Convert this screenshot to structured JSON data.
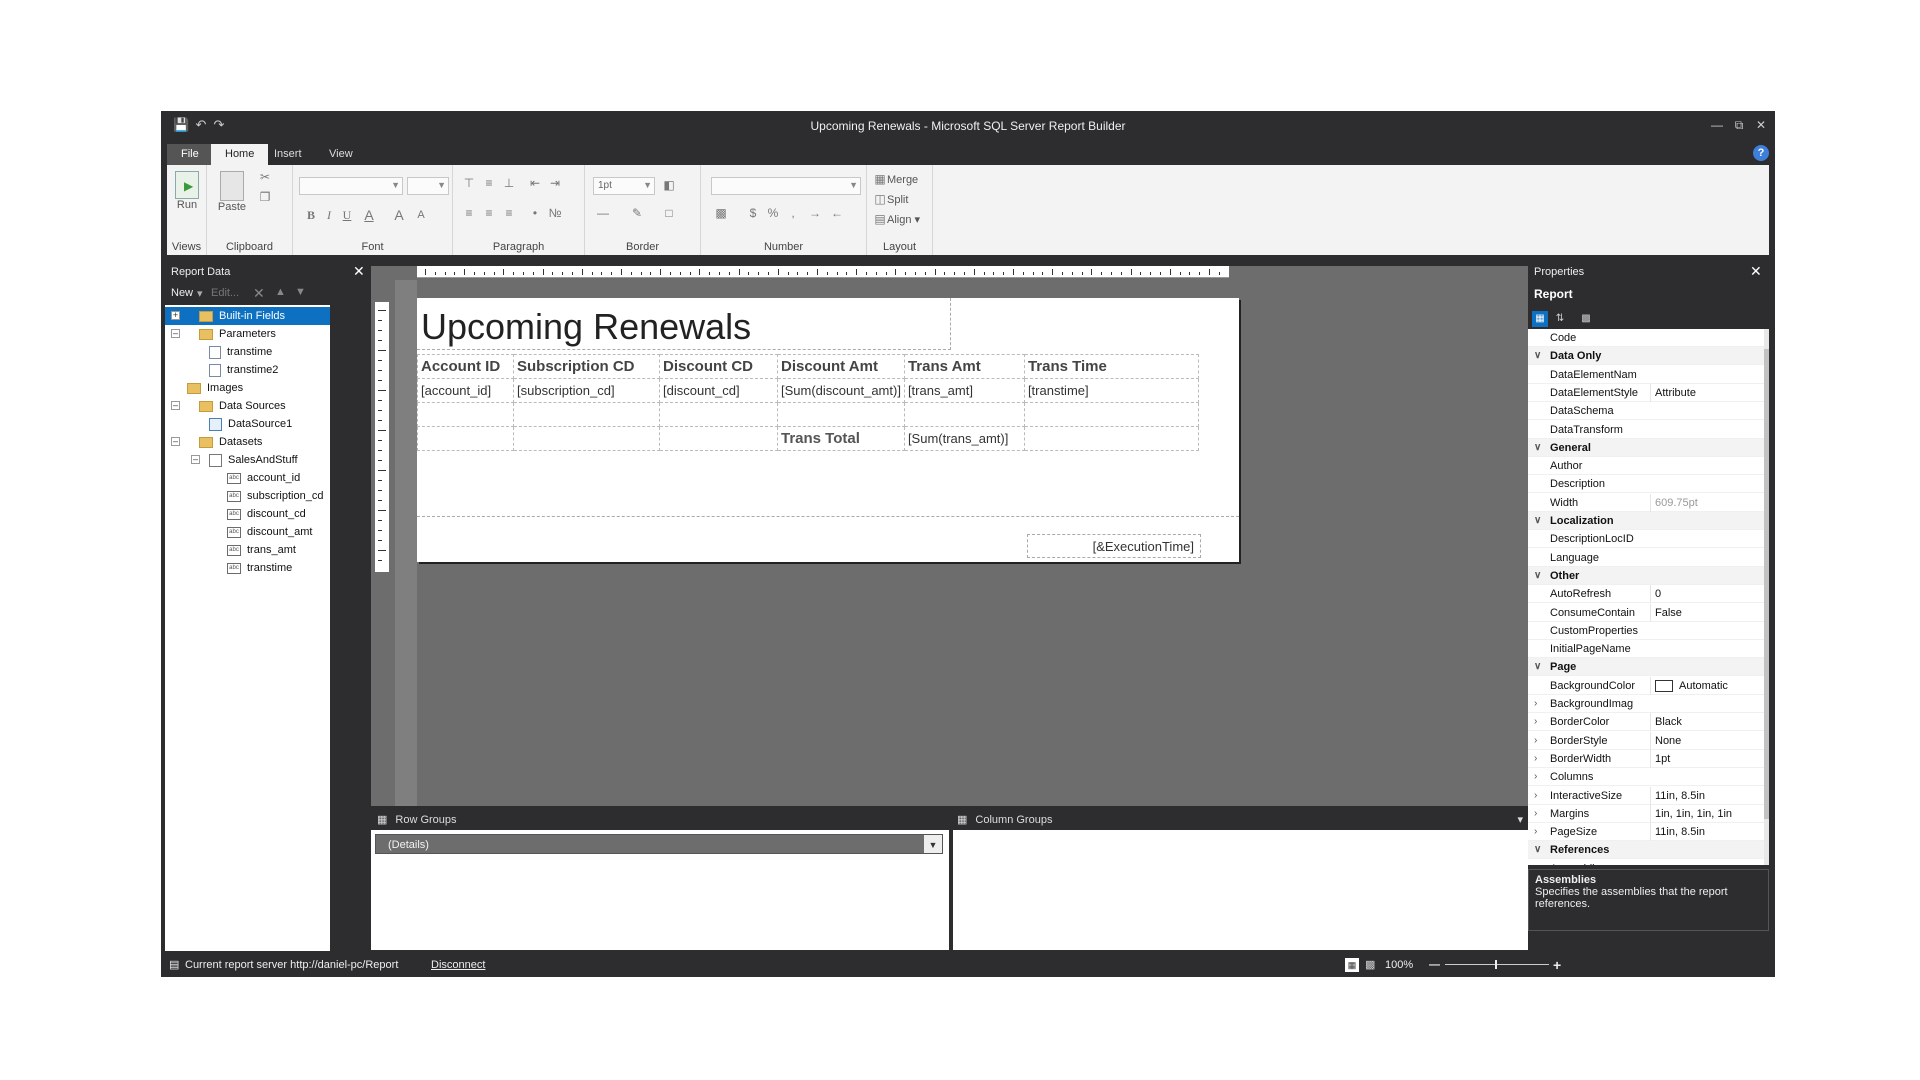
{
  "window": {
    "title": "Upcoming Renewals - Microsoft SQL Server Report Builder"
  },
  "menu": {
    "file": "File",
    "home": "Home",
    "insert": "Insert",
    "view": "View",
    "help": "?"
  },
  "ribbon": {
    "run": "Run",
    "paste": "Paste",
    "groups": {
      "views": "Views",
      "clipboard": "Clipboard",
      "font": "Font",
      "paragraph": "Paragraph",
      "border": "Border",
      "number": "Number",
      "layout": "Layout"
    },
    "border_width": "1pt",
    "merge": "Merge",
    "split": "Split",
    "align": "Align",
    "bold": "B",
    "italic": "I",
    "underline": "U",
    "fontcolor": "A",
    "fontsize_up": "A",
    "number_currency": "$",
    "number_percent": "%",
    "number_comma": ","
  },
  "report_data": {
    "title": "Report Data",
    "toolbar": {
      "new": "New",
      "edit": "Edit..."
    },
    "tree": {
      "builtin": "Built-in Fields",
      "parameters": "Parameters",
      "param1": "transtime",
      "param2": "transtime2",
      "images": "Images",
      "datasources": "Data Sources",
      "datasource1": "DataSource1",
      "datasets": "Datasets",
      "dataset1": "SalesAndStuff",
      "fields": [
        "account_id",
        "subscription_cd",
        "discount_cd",
        "discount_amt",
        "trans_amt",
        "transtime"
      ]
    }
  },
  "report": {
    "title": "Upcoming Renewals",
    "headers": [
      "Account ID",
      "Subscription CD",
      "Discount CD",
      "Discount Amt",
      "Trans Amt",
      "Trans Time"
    ],
    "detail": [
      "[account_id]",
      "[subscription_cd]",
      "[discount_cd]",
      "[Sum(discount_amt)]",
      "[trans_amt]",
      "[transtime]"
    ],
    "total_label": "Trans Total",
    "total_value": "[Sum(trans_amt)]",
    "footer": "[&ExecutionTime]"
  },
  "groups": {
    "row": "Row Groups",
    "column": "Column Groups",
    "details": "(Details)"
  },
  "properties": {
    "title": "Properties",
    "object": "Report",
    "rows": [
      {
        "name": "Code",
        "value": "",
        "cat": false
      },
      {
        "name": "Data Only",
        "value": "",
        "cat": true
      },
      {
        "name": "DataElementNam",
        "value": "",
        "cat": false
      },
      {
        "name": "DataElementStyle",
        "value": "Attribute",
        "cat": false
      },
      {
        "name": "DataSchema",
        "value": "",
        "cat": false
      },
      {
        "name": "DataTransform",
        "value": "",
        "cat": false
      },
      {
        "name": "General",
        "value": "",
        "cat": true
      },
      {
        "name": "Author",
        "value": "",
        "cat": false
      },
      {
        "name": "Description",
        "value": "",
        "cat": false
      },
      {
        "name": "Width",
        "value": "609.75pt",
        "cat": false
      },
      {
        "name": "Localization",
        "value": "",
        "cat": true
      },
      {
        "name": "DescriptionLocID",
        "value": "",
        "cat": false
      },
      {
        "name": "Language",
        "value": "",
        "cat": false
      },
      {
        "name": "Other",
        "value": "",
        "cat": true
      },
      {
        "name": "AutoRefresh",
        "value": "0",
        "cat": false
      },
      {
        "name": "ConsumeContain",
        "value": "False",
        "cat": false
      },
      {
        "name": "CustomProperties",
        "value": "",
        "cat": false
      },
      {
        "name": "InitialPageName",
        "value": "",
        "cat": false
      },
      {
        "name": "Page",
        "value": "",
        "cat": true
      },
      {
        "name": "BackgroundColor",
        "value": "Automatic",
        "cat": false
      },
      {
        "name": "BackgroundImag",
        "value": "",
        "cat": false
      },
      {
        "name": "BorderColor",
        "value": "Black",
        "cat": false
      },
      {
        "name": "BorderStyle",
        "value": "None",
        "cat": false
      },
      {
        "name": "BorderWidth",
        "value": "1pt",
        "cat": false
      },
      {
        "name": "Columns",
        "value": "",
        "cat": false
      },
      {
        "name": "InteractiveSize",
        "value": "11in, 8.5in",
        "cat": false
      },
      {
        "name": "Margins",
        "value": "1in, 1in, 1in, 1in",
        "cat": false
      },
      {
        "name": "PageSize",
        "value": "11in, 8.5in",
        "cat": false
      },
      {
        "name": "References",
        "value": "",
        "cat": true
      },
      {
        "name": "Assemblies",
        "value": "",
        "cat": false
      }
    ],
    "desc_title": "Assemblies",
    "desc_text": "Specifies the assemblies that the report references."
  },
  "status": {
    "server": "Current report server http://daniel-pc/Report",
    "disconnect": "Disconnect",
    "zoom": "100%"
  },
  "colors": {
    "accent": "#0e70c0",
    "chrome": "#2d2d30",
    "canvas": "#6d6d6d"
  }
}
